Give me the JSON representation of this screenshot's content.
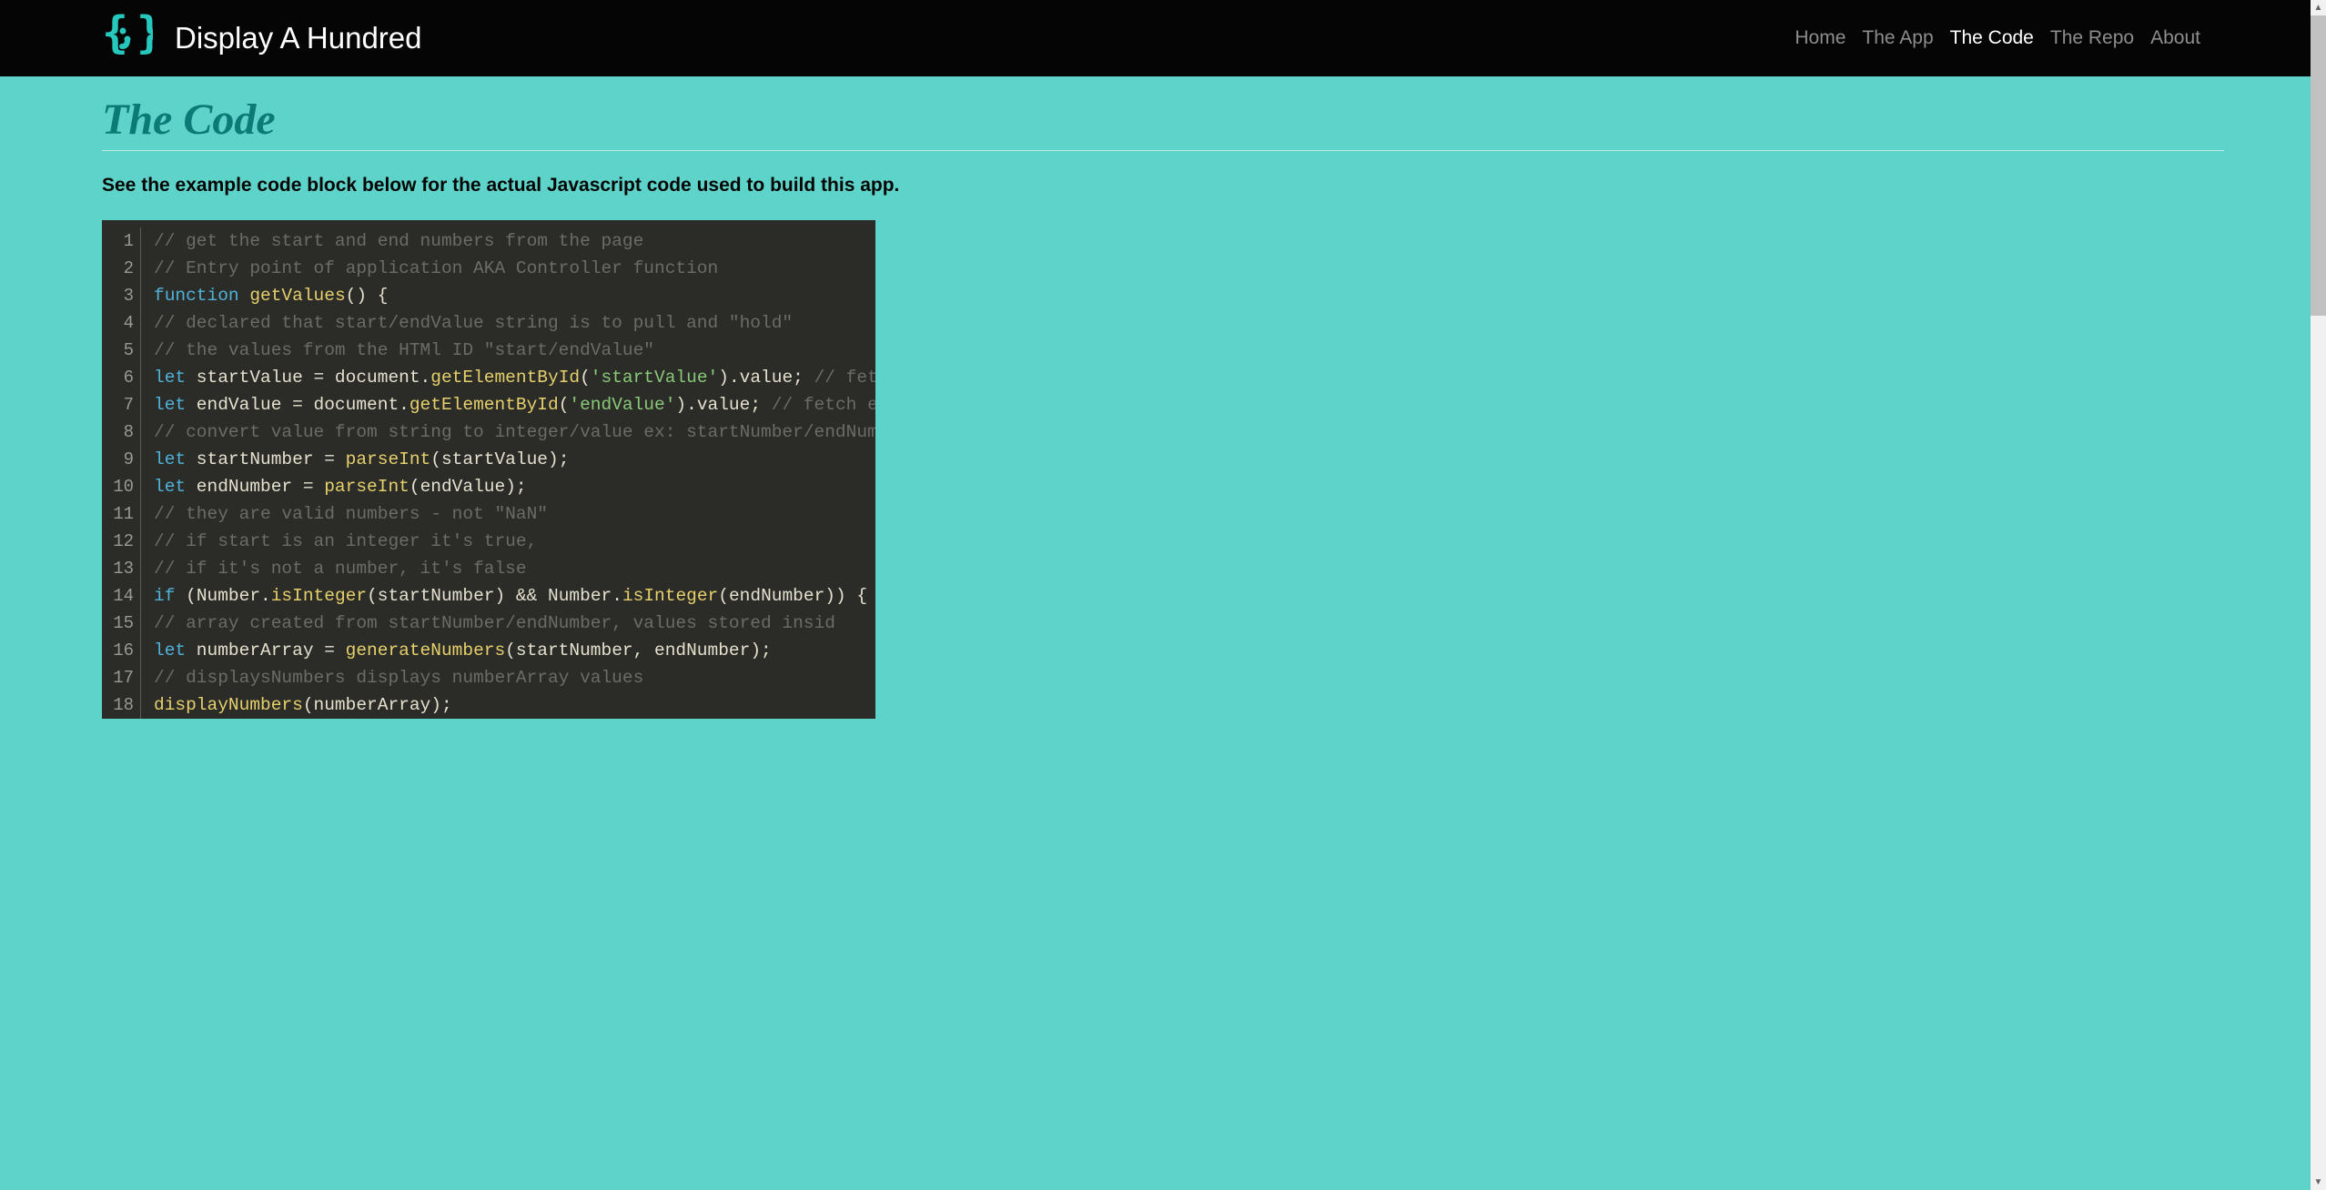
{
  "brand": {
    "title": "Display A Hundred"
  },
  "nav": {
    "items": [
      {
        "label": "Home",
        "active": false
      },
      {
        "label": "The App",
        "active": false
      },
      {
        "label": "The Code",
        "active": true
      },
      {
        "label": "The Repo",
        "active": false
      },
      {
        "label": "About",
        "active": false
      }
    ]
  },
  "page": {
    "title": "The Code",
    "subtitle": "See the example code block below for the actual Javascript code used to build this app."
  },
  "code": {
    "line_numbers": [
      "1",
      "2",
      "3",
      "4",
      "5",
      "6",
      "7",
      "8",
      "9",
      "10",
      "11",
      "12",
      "13",
      "14",
      "15",
      "16",
      "17",
      "18"
    ],
    "lines": [
      [
        {
          "t": "comment",
          "v": "// get the start and end numbers from the page"
        }
      ],
      [
        {
          "t": "comment",
          "v": "// Entry point of application AKA Controller function"
        }
      ],
      [
        {
          "t": "keyword",
          "v": "function"
        },
        {
          "t": "plain",
          "v": " "
        },
        {
          "t": "func",
          "v": "getValues"
        },
        {
          "t": "paren",
          "v": "() {"
        }
      ],
      [
        {
          "t": "comment",
          "v": "// declared that start/endValue string is to pull and \"hold\""
        }
      ],
      [
        {
          "t": "comment",
          "v": "// the values from the HTMl ID \"start/endValue\""
        }
      ],
      [
        {
          "t": "plain",
          "v": "    "
        },
        {
          "t": "keyword",
          "v": "let"
        },
        {
          "t": "plain",
          "v": " startValue = document."
        },
        {
          "t": "func",
          "v": "getElementById"
        },
        {
          "t": "paren",
          "v": "("
        },
        {
          "t": "string",
          "v": "'startValue'"
        },
        {
          "t": "paren",
          "v": ")"
        },
        {
          "t": "plain",
          "v": ".value; "
        },
        {
          "t": "comment",
          "v": "// fetc"
        }
      ],
      [
        {
          "t": "plain",
          "v": "    "
        },
        {
          "t": "keyword",
          "v": "let"
        },
        {
          "t": "plain",
          "v": " endValue = document."
        },
        {
          "t": "func",
          "v": "getElementById"
        },
        {
          "t": "paren",
          "v": "("
        },
        {
          "t": "string",
          "v": "'endValue'"
        },
        {
          "t": "paren",
          "v": ")"
        },
        {
          "t": "plain",
          "v": ".value; "
        },
        {
          "t": "comment",
          "v": "// fetch e"
        }
      ],
      [
        {
          "t": "comment",
          "v": "// convert value from string to integer/value ex: startNumber/endNumber"
        }
      ],
      [
        {
          "t": "plain",
          "v": "    "
        },
        {
          "t": "keyword",
          "v": "let"
        },
        {
          "t": "plain",
          "v": " startNumber = "
        },
        {
          "t": "func",
          "v": "parseInt"
        },
        {
          "t": "paren",
          "v": "("
        },
        {
          "t": "plain",
          "v": "startValue"
        },
        {
          "t": "paren",
          "v": ");"
        }
      ],
      [
        {
          "t": "plain",
          "v": "    "
        },
        {
          "t": "keyword",
          "v": "let"
        },
        {
          "t": "plain",
          "v": " endNumber = "
        },
        {
          "t": "func",
          "v": "parseInt"
        },
        {
          "t": "paren",
          "v": "("
        },
        {
          "t": "plain",
          "v": "endValue"
        },
        {
          "t": "paren",
          "v": ");"
        }
      ],
      [
        {
          "t": "comment",
          "v": "// they are valid numbers - not \"NaN\""
        }
      ],
      [
        {
          "t": "comment",
          "v": "// if start is an integer it's true,"
        }
      ],
      [
        {
          "t": "comment",
          "v": "// if it's not a number, it's false"
        }
      ],
      [
        {
          "t": "plain",
          "v": "    "
        },
        {
          "t": "keyword",
          "v": "if"
        },
        {
          "t": "plain",
          "v": " "
        },
        {
          "t": "paren",
          "v": "("
        },
        {
          "t": "plain",
          "v": "Number."
        },
        {
          "t": "func",
          "v": "isInteger"
        },
        {
          "t": "paren",
          "v": "("
        },
        {
          "t": "plain",
          "v": "startNumber"
        },
        {
          "t": "paren",
          "v": ")"
        },
        {
          "t": "plain",
          "v": " && Number."
        },
        {
          "t": "func",
          "v": "isInteger"
        },
        {
          "t": "paren",
          "v": "("
        },
        {
          "t": "plain",
          "v": "endNumber"
        },
        {
          "t": "paren",
          "v": ")) {"
        }
      ],
      [
        {
          "t": "plain",
          "v": "        "
        },
        {
          "t": "comment",
          "v": "// array created from startNumber/endNumber, values stored insid"
        }
      ],
      [
        {
          "t": "plain",
          "v": "    "
        },
        {
          "t": "keyword",
          "v": "let"
        },
        {
          "t": "plain",
          "v": " numberArray = "
        },
        {
          "t": "func",
          "v": "generateNumbers"
        },
        {
          "t": "paren",
          "v": "("
        },
        {
          "t": "plain",
          "v": "startNumber, endNumber"
        },
        {
          "t": "paren",
          "v": ");"
        }
      ],
      [
        {
          "t": "plain",
          "v": "    "
        },
        {
          "t": "comment",
          "v": "// displaysNumbers displays numberArray values"
        }
      ],
      [
        {
          "t": "plain",
          "v": "        "
        },
        {
          "t": "func",
          "v": "displayNumbers"
        },
        {
          "t": "paren",
          "v": "("
        },
        {
          "t": "plain",
          "v": "numberArray"
        },
        {
          "t": "paren",
          "v": ");"
        }
      ]
    ]
  }
}
